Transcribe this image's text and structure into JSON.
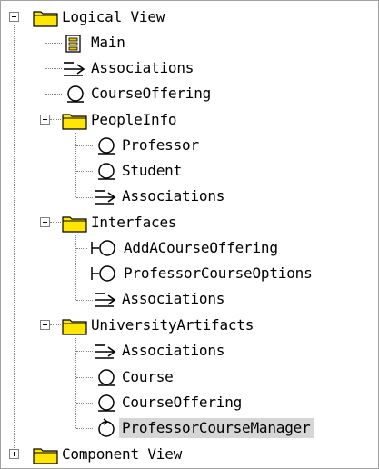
{
  "tree": {
    "logical_view": {
      "label": "Logical View",
      "expander": "minus"
    },
    "main": {
      "label": "Main"
    },
    "associations_1": {
      "label": "Associations"
    },
    "course_offering_1": {
      "label": "CourseOffering"
    },
    "people_info": {
      "label": "PeopleInfo",
      "expander": "minus"
    },
    "professor": {
      "label": "Professor"
    },
    "student": {
      "label": "Student"
    },
    "associations_2": {
      "label": "Associations"
    },
    "interfaces": {
      "label": "Interfaces",
      "expander": "minus"
    },
    "add_a_course_offering": {
      "label": "AddACourseOffering"
    },
    "professor_course_options": {
      "label": "ProfessorCourseOptions"
    },
    "associations_3": {
      "label": "Associations"
    },
    "university_artifacts": {
      "label": "UniversityArtifacts",
      "expander": "minus"
    },
    "associations_4": {
      "label": "Associations"
    },
    "course": {
      "label": "Course"
    },
    "course_offering_2": {
      "label": "CourseOffering"
    },
    "professor_course_manager": {
      "label": "ProfessorCourseManager",
      "selected": true
    },
    "component_view": {
      "label": "Component View",
      "expander": "plus"
    }
  },
  "colors": {
    "folder": "#ffe600",
    "selection": "#d6d6d6",
    "tree_lines": "#808080"
  }
}
